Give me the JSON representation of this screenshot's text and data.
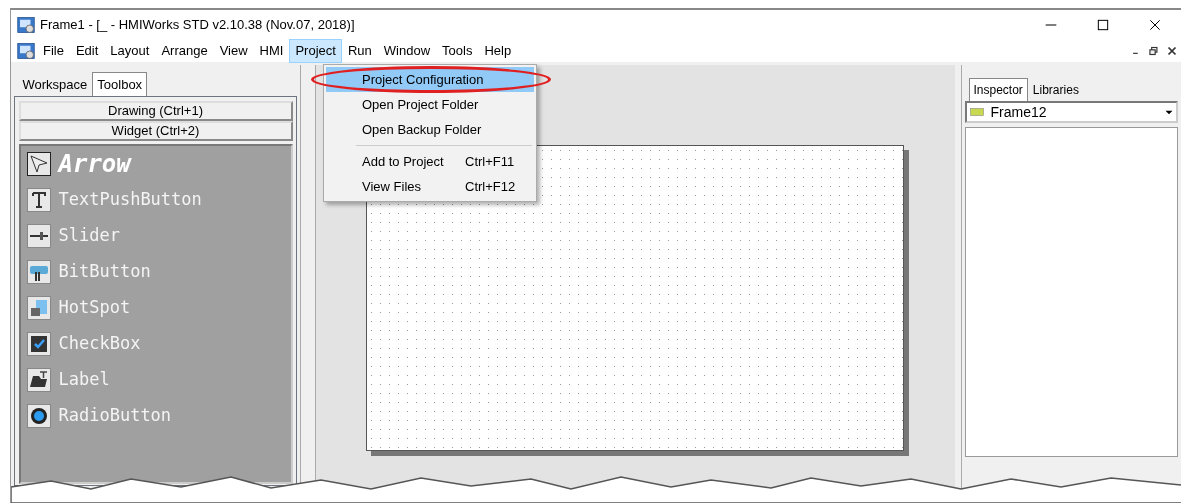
{
  "window": {
    "title": "Frame1 - [_ - HMIWorks STD v2.10.38 (Nov.07, 2018)]"
  },
  "menu": [
    {
      "label": "File",
      "selected": false
    },
    {
      "label": "Edit",
      "selected": false
    },
    {
      "label": "Layout",
      "selected": false
    },
    {
      "label": "Arrange",
      "selected": false
    },
    {
      "label": "View",
      "selected": false
    },
    {
      "label": "HMI",
      "selected": false
    },
    {
      "label": "Project",
      "selected": true
    },
    {
      "label": "Run",
      "selected": false
    },
    {
      "label": "Window",
      "selected": false
    },
    {
      "label": "Tools",
      "selected": false
    },
    {
      "label": "Help",
      "selected": false
    }
  ],
  "dropdown": {
    "groups": [
      [
        {
          "label": "Project Configuration",
          "selected": true
        },
        {
          "label": "Open Project Folder",
          "selected": false
        },
        {
          "label": "Open Backup Folder",
          "selected": false
        }
      ],
      [
        {
          "label": "Add to Project",
          "shortcut": "Ctrl+F11",
          "selected": false
        },
        {
          "label": "View Files",
          "shortcut": "Ctrl+F12",
          "selected": false
        }
      ]
    ]
  },
  "left_tabs": [
    {
      "label": "Workspace",
      "selected": false
    },
    {
      "label": "Toolbox",
      "selected": true
    }
  ],
  "toolbox": {
    "sections": [
      "Drawing (Ctrl+1)",
      "Widget (Ctrl+2)"
    ],
    "widgets": [
      {
        "label": "Arrow",
        "selected": true
      },
      {
        "label": "TextPushButton",
        "selected": false
      },
      {
        "label": "Slider",
        "selected": false
      },
      {
        "label": "BitButton",
        "selected": false
      },
      {
        "label": "HotSpot",
        "selected": false
      },
      {
        "label": "CheckBox",
        "selected": false
      },
      {
        "label": "Label",
        "selected": false
      },
      {
        "label": "RadioButton",
        "selected": false
      }
    ]
  },
  "right_tabs": [
    {
      "label": "Inspector",
      "selected": true
    },
    {
      "label": "Libraries",
      "selected": false
    }
  ],
  "inspector": {
    "object": "Frame12"
  }
}
